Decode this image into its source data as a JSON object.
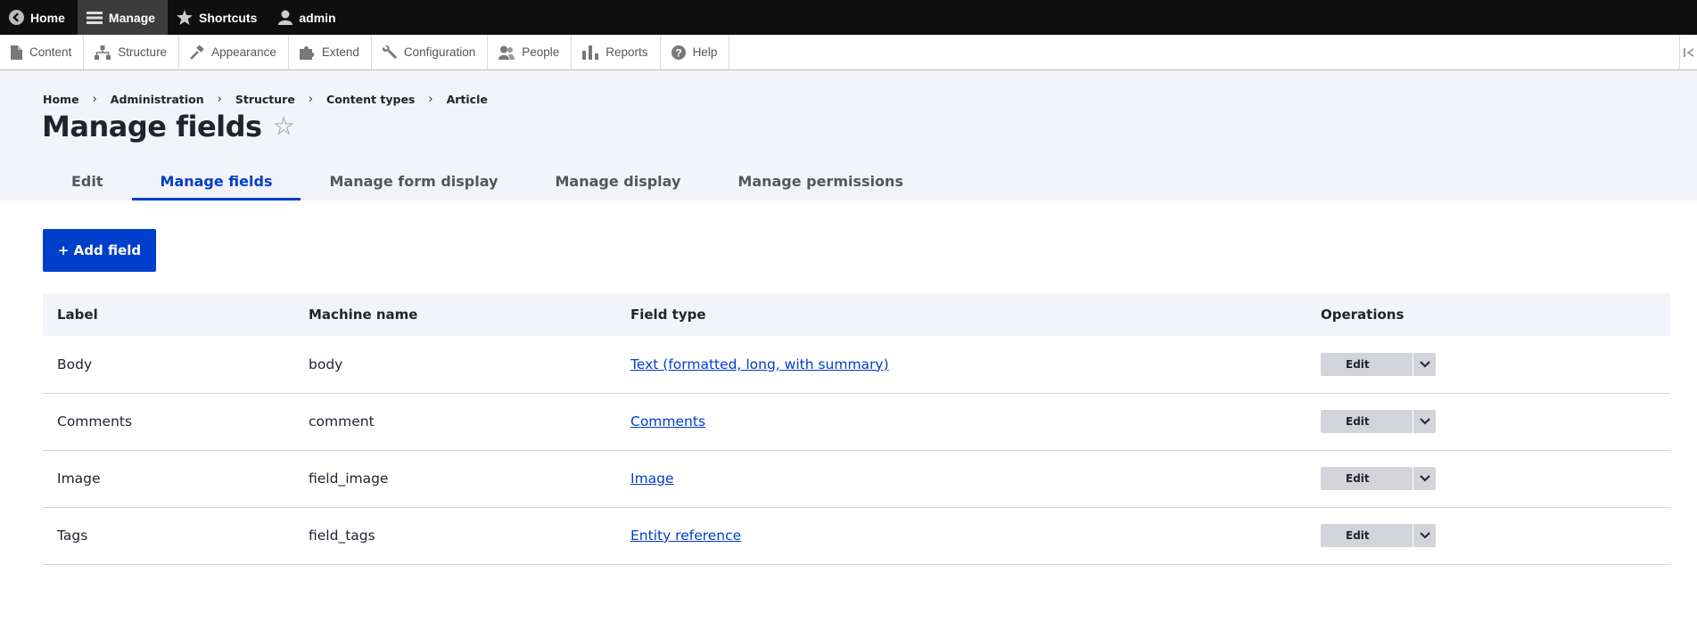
{
  "toolbar": {
    "items": [
      {
        "label": "Home",
        "icon": "back-arrow-icon"
      },
      {
        "label": "Manage",
        "icon": "hamburger-icon"
      },
      {
        "label": "Shortcuts",
        "icon": "star-icon"
      },
      {
        "label": "admin",
        "icon": "user-icon"
      }
    ]
  },
  "tray": {
    "items": [
      {
        "label": "Content",
        "icon": "file-icon"
      },
      {
        "label": "Structure",
        "icon": "sitemap-icon"
      },
      {
        "label": "Appearance",
        "icon": "brush-icon"
      },
      {
        "label": "Extend",
        "icon": "puzzle-icon"
      },
      {
        "label": "Configuration",
        "icon": "wrench-icon"
      },
      {
        "label": "People",
        "icon": "people-icon"
      },
      {
        "label": "Reports",
        "icon": "bar-chart-icon"
      },
      {
        "label": "Help",
        "icon": "help-icon"
      }
    ]
  },
  "breadcrumb": [
    "Home",
    "Administration",
    "Structure",
    "Content types",
    "Article"
  ],
  "breadcrumb_separator": "›",
  "page": {
    "title": "Manage fields",
    "star": "☆"
  },
  "tabs": [
    {
      "label": "Edit",
      "active": false
    },
    {
      "label": "Manage fields",
      "active": true
    },
    {
      "label": "Manage form display",
      "active": false
    },
    {
      "label": "Manage display",
      "active": false
    },
    {
      "label": "Manage permissions",
      "active": false
    }
  ],
  "add_field_label": "+ Add field",
  "table": {
    "headers": [
      "Label",
      "Machine name",
      "Field type",
      "Operations"
    ],
    "rows": [
      {
        "label": "Body",
        "machine": "body",
        "type": "Text (formatted, long, with summary)",
        "op": "Edit"
      },
      {
        "label": "Comments",
        "machine": "comment",
        "type": "Comments",
        "op": "Edit"
      },
      {
        "label": "Image",
        "machine": "field_image",
        "type": "Image",
        "op": "Edit"
      },
      {
        "label": "Tags",
        "machine": "field_tags",
        "type": "Entity reference",
        "op": "Edit"
      }
    ]
  },
  "colors": {
    "accent": "#003ecc",
    "toolbar_bg": "#0f0f0f",
    "header_bg": "#f3f4f9"
  }
}
